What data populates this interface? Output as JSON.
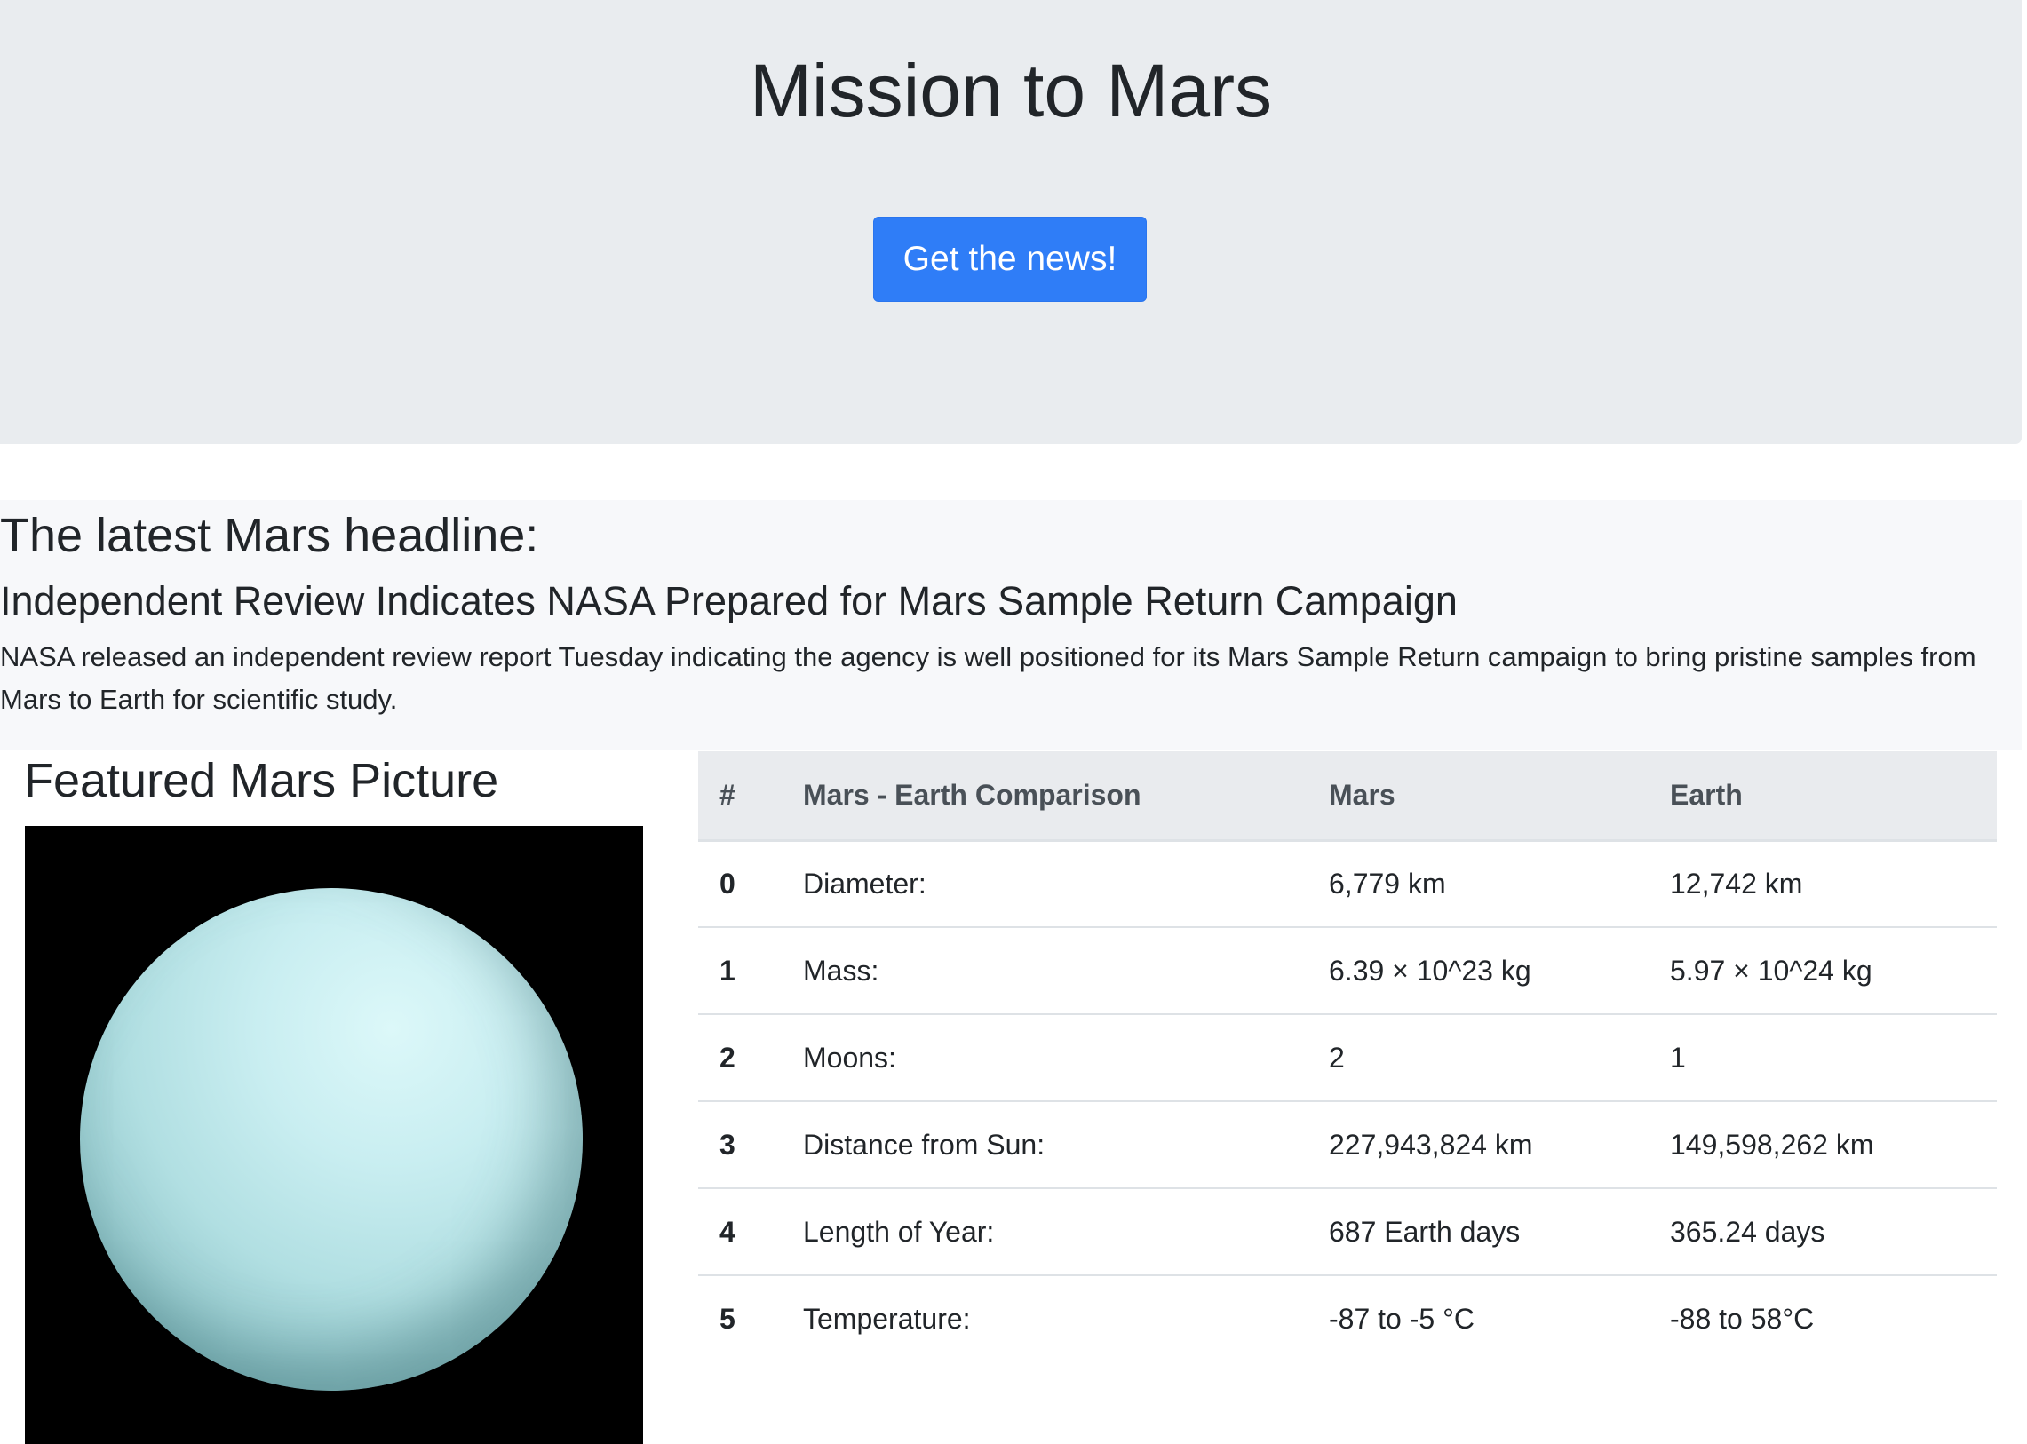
{
  "header": {
    "title": "Mission to Mars",
    "button_label": "Get the news!"
  },
  "headline_section": {
    "heading": "The latest Mars headline:",
    "news_title": "Independent Review Indicates NASA Prepared for Mars Sample Return Campaign",
    "news_paragraph": "NASA released an independent review report Tuesday indicating the agency is well positioned for its Mars Sample Return campaign to bring pristine samples from Mars to Earth for scientific study."
  },
  "featured_image": {
    "heading": "Featured Mars Picture"
  },
  "facts_table": {
    "columns": [
      "#",
      "Mars - Earth Comparison",
      "Mars",
      "Earth"
    ],
    "rows": [
      [
        "0",
        "Diameter:",
        "6,779 km",
        "12,742 km"
      ],
      [
        "1",
        "Mass:",
        "6.39 × 10^23 kg",
        "5.97 × 10^24 kg"
      ],
      [
        "2",
        "Moons:",
        "2",
        "1"
      ],
      [
        "3",
        "Distance from Sun:",
        "227,943,824 km",
        "149,598,262 km"
      ],
      [
        "4",
        "Length of Year:",
        "687 Earth days",
        "365.24 days"
      ],
      [
        "5",
        "Temperature:",
        "-87 to -5 °C",
        "-88 to 58°C"
      ]
    ]
  },
  "colors": {
    "jumbotron_bg": "#e9ecef",
    "button_bg": "#2f7df7",
    "headline_bg": "#f7f8fa",
    "table_header_bg": "#e9ebee"
  }
}
